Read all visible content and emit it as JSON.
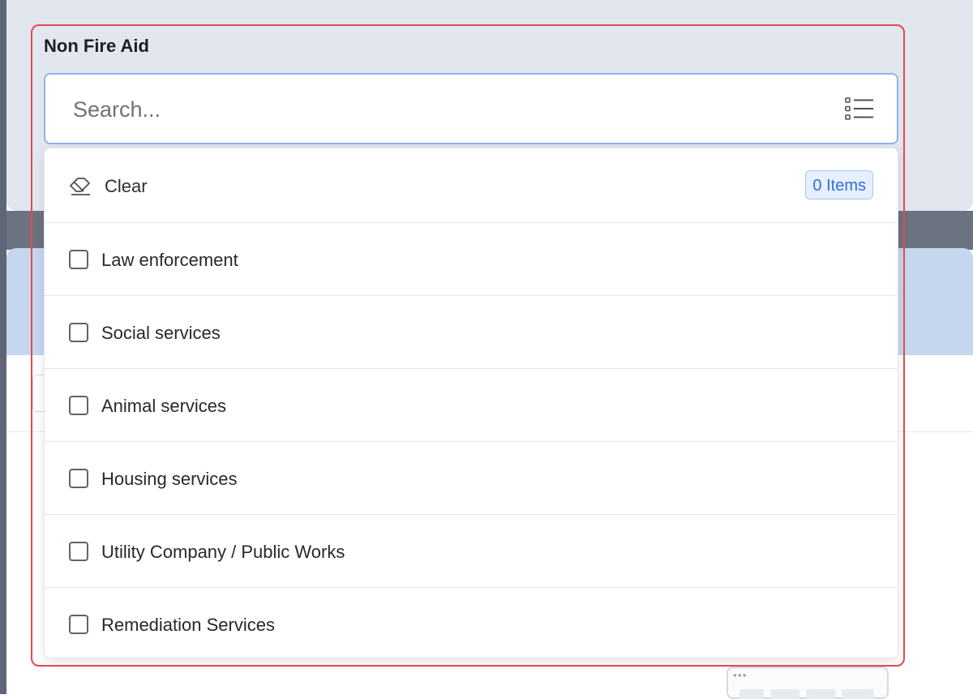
{
  "field": {
    "label": "Non Fire Aid",
    "search_placeholder": "Search...",
    "list_icon": "list-icon"
  },
  "dropdown": {
    "clear_label": "Clear",
    "clear_icon": "eraser-icon",
    "items_count": "0 Items",
    "options": [
      {
        "label": "Law enforcement",
        "checked": false
      },
      {
        "label": "Social services",
        "checked": false
      },
      {
        "label": "Animal services",
        "checked": false
      },
      {
        "label": "Housing services",
        "checked": false
      },
      {
        "label": "Utility Company / Public Works",
        "checked": false
      },
      {
        "label": "Remediation Services",
        "checked": false
      }
    ]
  },
  "colors": {
    "highlight": "#e5474f",
    "focus_border": "#8fb3ee",
    "badge_text": "#2f6fd6",
    "badge_bg": "#e6efff"
  }
}
